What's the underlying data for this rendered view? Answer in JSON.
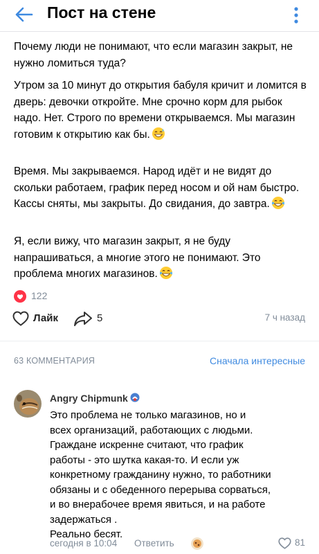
{
  "header": {
    "title": "Пост на стене",
    "back_icon": "arrow-left-icon",
    "more_icon": "more-vertical-icon",
    "accent_color": "#3f8ae0"
  },
  "post": {
    "paragraphs": [
      "Почему люди не понимают, что если магазин закрыт, не нужно ломиться туда?",
      "Утром за 10 минут до открытия бабуля кричит и ломится в дверь: девочки откройте. Мне срочно корм для рыбок надо. Нет. Строго по времени открываемся. Мы магазин готовим к открытию как бы.",
      "Время. Мы закрываемся. Народ идёт и не видят до скольки работаем, график перед носом и ой нам быстро. Кассы сняты, мы закрыты. До свидания, до завтра.",
      "Я, если вижу, что магазин закрыт, я не буду напрашиваться, а многие этого не понимают. Это проблема многих магазинов."
    ],
    "emojis": [
      "grinning-sweat-emoji",
      "tears-of-joy-emoji",
      "tears-of-joy-emoji"
    ],
    "likes_count": "122",
    "like_label": "Лайк",
    "share_count": "5",
    "time": "7 ч назад"
  },
  "comments": {
    "count_label": "63 КОММЕНТАРИЯ",
    "sort_label": "Сначала интересные",
    "items": [
      {
        "author": "Angry Chipmunk",
        "text": "Это проблема не только магазинов,  но и\nвсех организаций, работающих с людьми.\nГраждане искренне считают, что график\nработы - это шутка какая-то. И если уж\nконкретному гражданину нужно, то работники\nобязаны и с обеденного перерыва сорваться,\nи во внерабочее время явиться, и на работе\nзадержаться .\nРеально бесят.",
        "timestamp": "сегодня в 10:04",
        "reply_label": "Ответить",
        "likes": "81"
      }
    ]
  }
}
